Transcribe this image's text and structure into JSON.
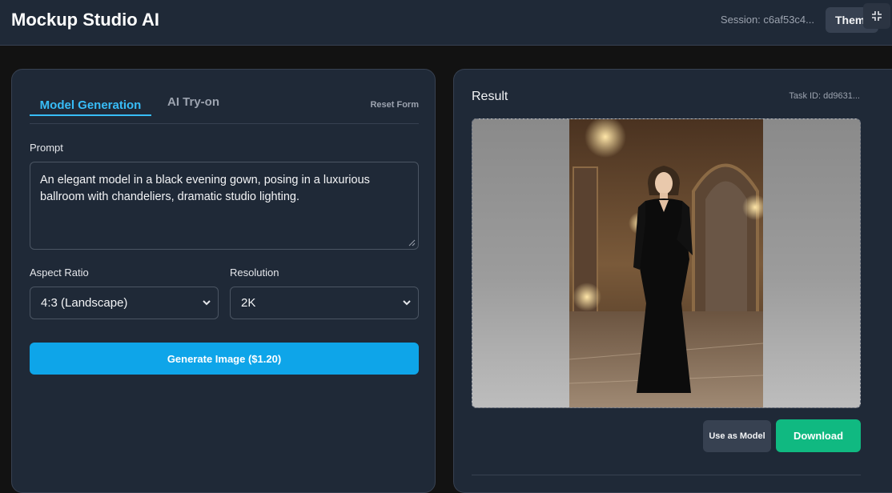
{
  "header": {
    "title": "Mockup Studio AI",
    "session": "Session: c6af53c4...",
    "theme_label": "Them",
    "fullscreen_icon": "collapse-icon"
  },
  "left": {
    "tabs": [
      "Model Generation",
      "AI Try-on"
    ],
    "active_tab": "Model Generation",
    "reset_label": "Reset Form",
    "prompt_label": "Prompt",
    "prompt_value": "An elegant model in a black evening gown, posing in a luxurious ballroom with chandeliers, dramatic studio lighting.",
    "aspect_label": "Aspect Ratio",
    "aspect_value": "4:3 (Landscape)",
    "resolution_label": "Resolution",
    "resolution_value": "2K",
    "generate_label": "Generate Image ($1.20)"
  },
  "right": {
    "title": "Result",
    "task_id": "Task ID: dd9631...",
    "use_model_label": "Use as Model",
    "download_label": "Download"
  },
  "colors": {
    "accent": "#0ea5e9",
    "tab_active": "#38bdf8",
    "download": "#10b981",
    "panel": "#1f2937",
    "background": "#121212"
  }
}
